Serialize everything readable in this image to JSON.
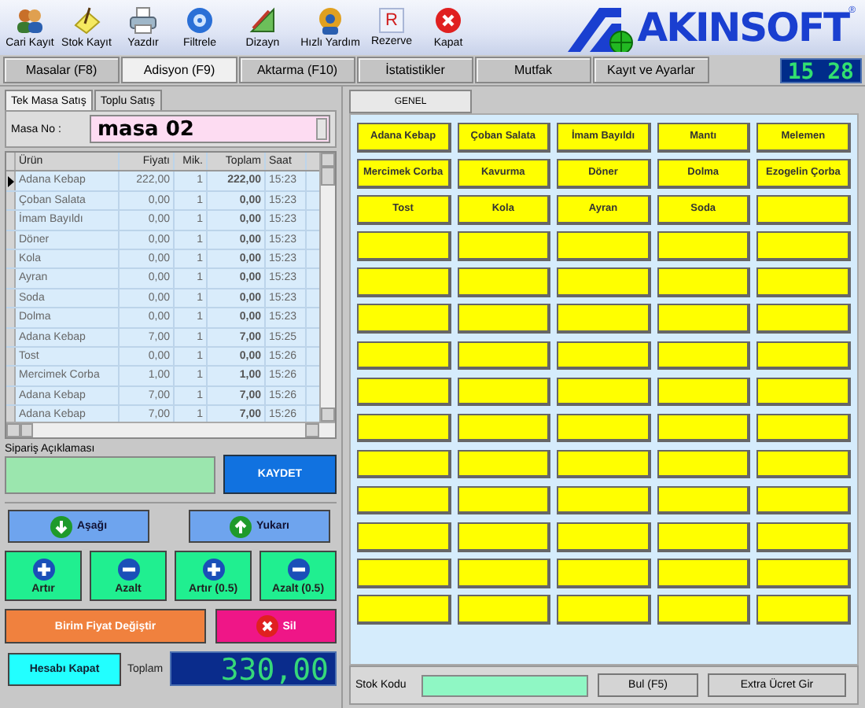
{
  "toolbar": [
    {
      "label": "Cari Kayıt",
      "kind": "people"
    },
    {
      "label": "Stok Kayıt",
      "kind": "note"
    },
    {
      "label": "Yazdır",
      "kind": "printer"
    },
    {
      "label": "Filtrele",
      "kind": "disc"
    },
    {
      "label": "Dizayn",
      "kind": "ruler"
    },
    {
      "label": "Hızlı Yardım",
      "kind": "help"
    },
    {
      "label": "Rezerve",
      "kind": "letter",
      "glyph": "R"
    },
    {
      "label": "Kapat",
      "kind": "close"
    }
  ],
  "logo": {
    "text": "AKINSOFT",
    "mark": "®"
  },
  "tabs": [
    {
      "label": "Masalar (F8)",
      "selected": false
    },
    {
      "label": "Adisyon (F9)",
      "selected": true
    },
    {
      "label": "Aktarma (F10)",
      "selected": false
    },
    {
      "label": "İstatistikler",
      "selected": false
    },
    {
      "label": "Mutfak",
      "selected": false
    },
    {
      "label": "Kayıt ve Ayarlar",
      "selected": false
    }
  ],
  "clock": "15 28",
  "sale_tabs": [
    {
      "label": "Tek Masa Satış",
      "selected": true
    },
    {
      "label": "Toplu Satış",
      "selected": false
    }
  ],
  "table_no": {
    "label": "Masa No :",
    "value": "masa 02"
  },
  "order_table": {
    "columns": [
      "Ürün",
      "Fiyatı",
      "Mik.",
      "Toplam",
      "Saat"
    ],
    "rows": [
      {
        "selected": true,
        "cells": [
          "Adana Kebap",
          "222,00",
          "1",
          "222,00",
          "15:23"
        ]
      },
      {
        "selected": false,
        "cells": [
          "Çoban Salata",
          "0,00",
          "1",
          "0,00",
          "15:23"
        ]
      },
      {
        "selected": false,
        "cells": [
          "İmam Bayıldı",
          "0,00",
          "1",
          "0,00",
          "15:23"
        ]
      },
      {
        "selected": false,
        "cells": [
          "Döner",
          "0,00",
          "1",
          "0,00",
          "15:23"
        ]
      },
      {
        "selected": false,
        "cells": [
          "Kola",
          "0,00",
          "1",
          "0,00",
          "15:23"
        ]
      },
      {
        "selected": false,
        "cells": [
          "Ayran",
          "0,00",
          "1",
          "0,00",
          "15:23"
        ]
      },
      {
        "selected": false,
        "cells": [
          "Soda",
          "0,00",
          "1",
          "0,00",
          "15:23"
        ]
      },
      {
        "selected": false,
        "cells": [
          "Dolma",
          "0,00",
          "1",
          "0,00",
          "15:23"
        ]
      },
      {
        "selected": false,
        "cells": [
          "Adana Kebap",
          "7,00",
          "1",
          "7,00",
          "15:25"
        ]
      },
      {
        "selected": false,
        "cells": [
          "Tost",
          "0,00",
          "1",
          "0,00",
          "15:26"
        ]
      },
      {
        "selected": false,
        "cells": [
          "Mercimek Corba",
          "1,00",
          "1",
          "1,00",
          "15:26"
        ]
      },
      {
        "selected": false,
        "cells": [
          "Adana Kebap",
          "7,00",
          "1",
          "7,00",
          "15:26"
        ]
      },
      {
        "selected": false,
        "cells": [
          "Adana Kebap",
          "7,00",
          "1",
          "7,00",
          "15:26"
        ]
      }
    ]
  },
  "order_note": {
    "label": "Sipariş Açıklaması",
    "save": "KAYDET"
  },
  "actions": [
    {
      "label": "Aşağı",
      "kind": "down"
    },
    {
      "label": "Yukarı",
      "kind": "up"
    },
    {
      "label": "Artır",
      "kind": "plus"
    },
    {
      "label": "Azalt",
      "kind": "minus"
    },
    {
      "label": "Artır (0.5)",
      "kind": "plus"
    },
    {
      "label": "Azalt (0.5)",
      "kind": "minus"
    },
    {
      "label": "Birim Fiyat Değiştir",
      "kind": "price"
    },
    {
      "label": "Sil",
      "kind": "delete"
    }
  ],
  "close_bill": "Hesabı Kapat",
  "total": {
    "label": "Toplam",
    "value": "330,00"
  },
  "category_tabs": [
    {
      "label": "GENEL",
      "selected": true
    }
  ],
  "products": [
    {
      "kind": "item",
      "label": "Adana Kebap"
    },
    {
      "kind": "item",
      "label": "Çoban Salata"
    },
    {
      "kind": "item",
      "label": "İmam Bayıldı"
    },
    {
      "kind": "item",
      "label": "Mantı"
    },
    {
      "kind": "item",
      "label": "Melemen"
    },
    {
      "kind": "item",
      "label": "Mercimek Corba"
    },
    {
      "kind": "item",
      "label": "Kavurma"
    },
    {
      "kind": "item",
      "label": "Döner"
    },
    {
      "kind": "item",
      "label": "Dolma"
    },
    {
      "kind": "item",
      "label": "Ezogelin Çorba"
    },
    {
      "kind": "item",
      "label": "Tost"
    },
    {
      "kind": "item",
      "label": "Kola"
    },
    {
      "kind": "item",
      "label": "Ayran"
    },
    {
      "kind": "item",
      "label": "Soda"
    },
    {
      "kind": "blank"
    },
    {
      "kind": "blank"
    },
    {
      "kind": "blank"
    },
    {
      "kind": "blank"
    },
    {
      "kind": "blank"
    },
    {
      "kind": "blank"
    },
    {
      "kind": "blank"
    },
    {
      "kind": "blank"
    },
    {
      "kind": "blank"
    },
    {
      "kind": "blank"
    },
    {
      "kind": "blank"
    },
    {
      "kind": "blank"
    },
    {
      "kind": "blank"
    },
    {
      "kind": "blank"
    },
    {
      "kind": "blank"
    },
    {
      "kind": "blank"
    },
    {
      "kind": "blank"
    },
    {
      "kind": "blank"
    },
    {
      "kind": "blank"
    },
    {
      "kind": "blank"
    },
    {
      "kind": "blank"
    },
    {
      "kind": "blank"
    },
    {
      "kind": "blank"
    },
    {
      "kind": "blank"
    },
    {
      "kind": "blank"
    },
    {
      "kind": "blank"
    },
    {
      "kind": "blank"
    },
    {
      "kind": "blank"
    },
    {
      "kind": "blank"
    },
    {
      "kind": "blank"
    },
    {
      "kind": "blank"
    },
    {
      "kind": "blank"
    },
    {
      "kind": "blank"
    },
    {
      "kind": "blank"
    },
    {
      "kind": "blank"
    },
    {
      "kind": "blank"
    },
    {
      "kind": "blank"
    },
    {
      "kind": "blank"
    },
    {
      "kind": "blank"
    },
    {
      "kind": "blank"
    },
    {
      "kind": "blank"
    },
    {
      "kind": "blank"
    },
    {
      "kind": "blank"
    },
    {
      "kind": "blank"
    },
    {
      "kind": "blank"
    },
    {
      "kind": "blank"
    },
    {
      "kind": "blank"
    },
    {
      "kind": "blank"
    },
    {
      "kind": "blank"
    },
    {
      "kind": "blank"
    },
    {
      "kind": "blank"
    },
    {
      "kind": "blank"
    },
    {
      "kind": "blank"
    },
    {
      "kind": "blank"
    },
    {
      "kind": "blank"
    },
    {
      "kind": "blank"
    }
  ],
  "footer": {
    "stock_label": "Stok Kodu",
    "find": "Bul (F5)",
    "extra": "Extra Ücret Gir"
  }
}
